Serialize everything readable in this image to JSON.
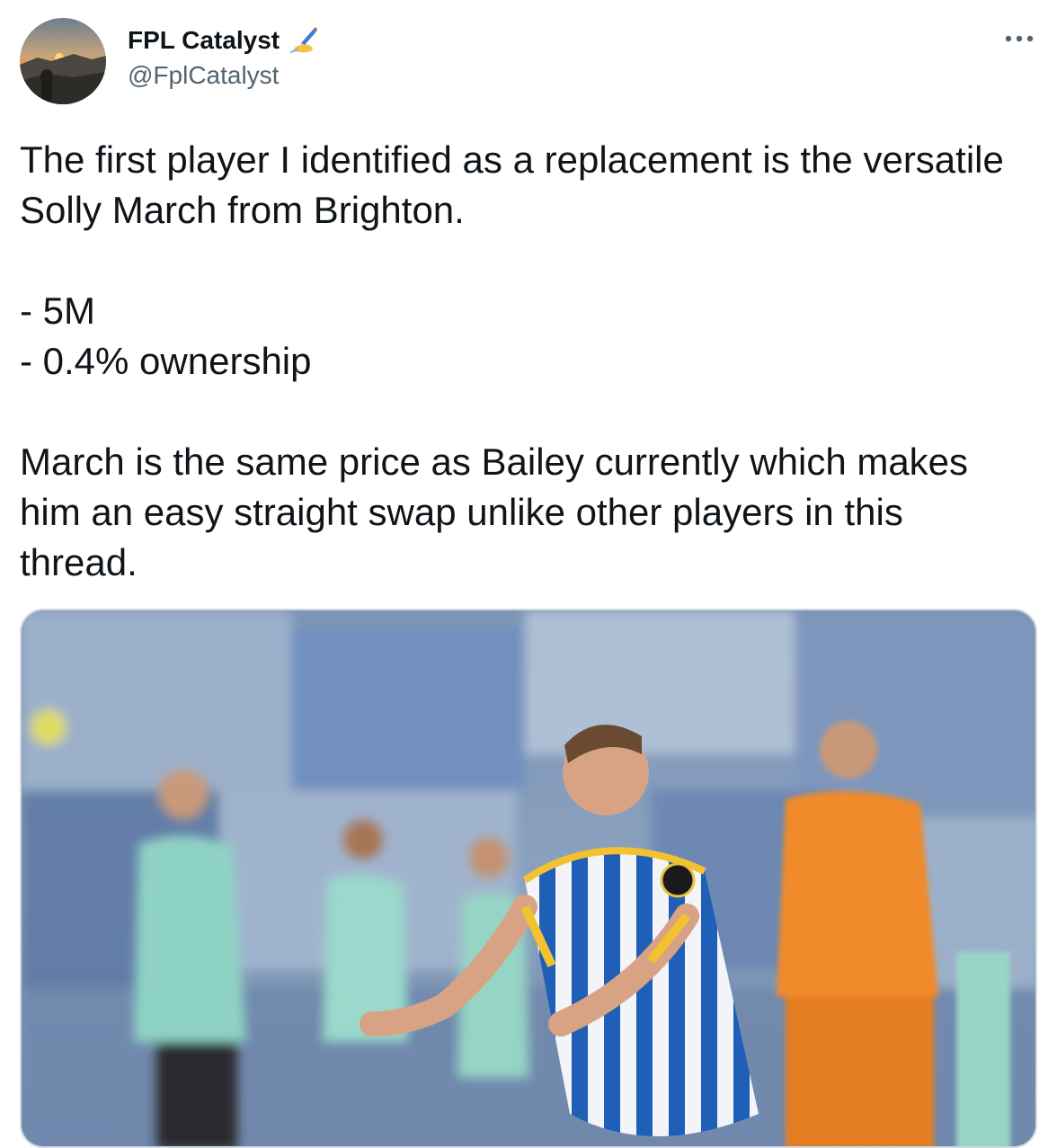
{
  "author": {
    "display_name": "FPL Catalyst",
    "name_emoji": "writing-hand-emoji",
    "handle": "@FplCatalyst",
    "avatar": "profile-avatar"
  },
  "more_icon": "more-options-icon",
  "tweet": {
    "paragraph_1": "The first player I identified as a replacement is the versatile Solly March from Brighton.",
    "list_item_1": "- 5M",
    "list_item_2": "- 0.4% ownership",
    "paragraph_2": "March is the same price as Bailey currently which makes him an easy straight swap unlike other players in this thread."
  },
  "media": {
    "type": "photo",
    "description_icon": "football-player-photo"
  },
  "colors": {
    "text": "#0f1419",
    "secondary": "#536471",
    "border": "#cfd9de"
  }
}
